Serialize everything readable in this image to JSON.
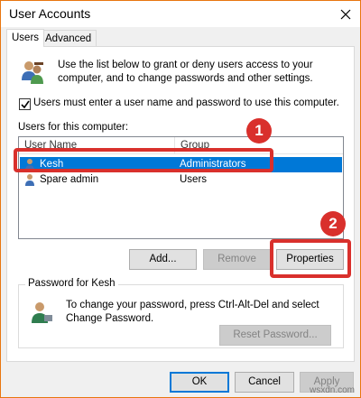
{
  "window": {
    "title": "User Accounts"
  },
  "tabs": [
    {
      "label": "Users"
    },
    {
      "label": "Advanced"
    }
  ],
  "intro_text": "Use the list below to grant or deny users access to your computer, and to change passwords and other settings.",
  "must_login": {
    "label": "Users must enter a user name and password to use this computer.",
    "checked": true
  },
  "users_label": "Users for this computer:",
  "users_table": {
    "columns": [
      "User Name",
      "Group"
    ],
    "rows": [
      {
        "name": "Kesh",
        "group": "Administrators",
        "selected": true
      },
      {
        "name": "Spare admin",
        "group": "Users",
        "selected": false
      }
    ]
  },
  "buttons": {
    "add": "Add...",
    "remove": "Remove",
    "properties": "Properties"
  },
  "password_group": {
    "title": "Password for Kesh",
    "text": "To change your password, press Ctrl-Alt-Del and select Change Password.",
    "reset_button": "Reset Password..."
  },
  "footer": {
    "ok": "OK",
    "cancel": "Cancel",
    "apply": "Apply"
  },
  "annotations": [
    {
      "number": "1"
    },
    {
      "number": "2"
    }
  ],
  "watermark": "wsxdn.com",
  "colors": {
    "accent": "#0078d7",
    "highlight": "#d9302c",
    "window_border": "#e8760f"
  }
}
